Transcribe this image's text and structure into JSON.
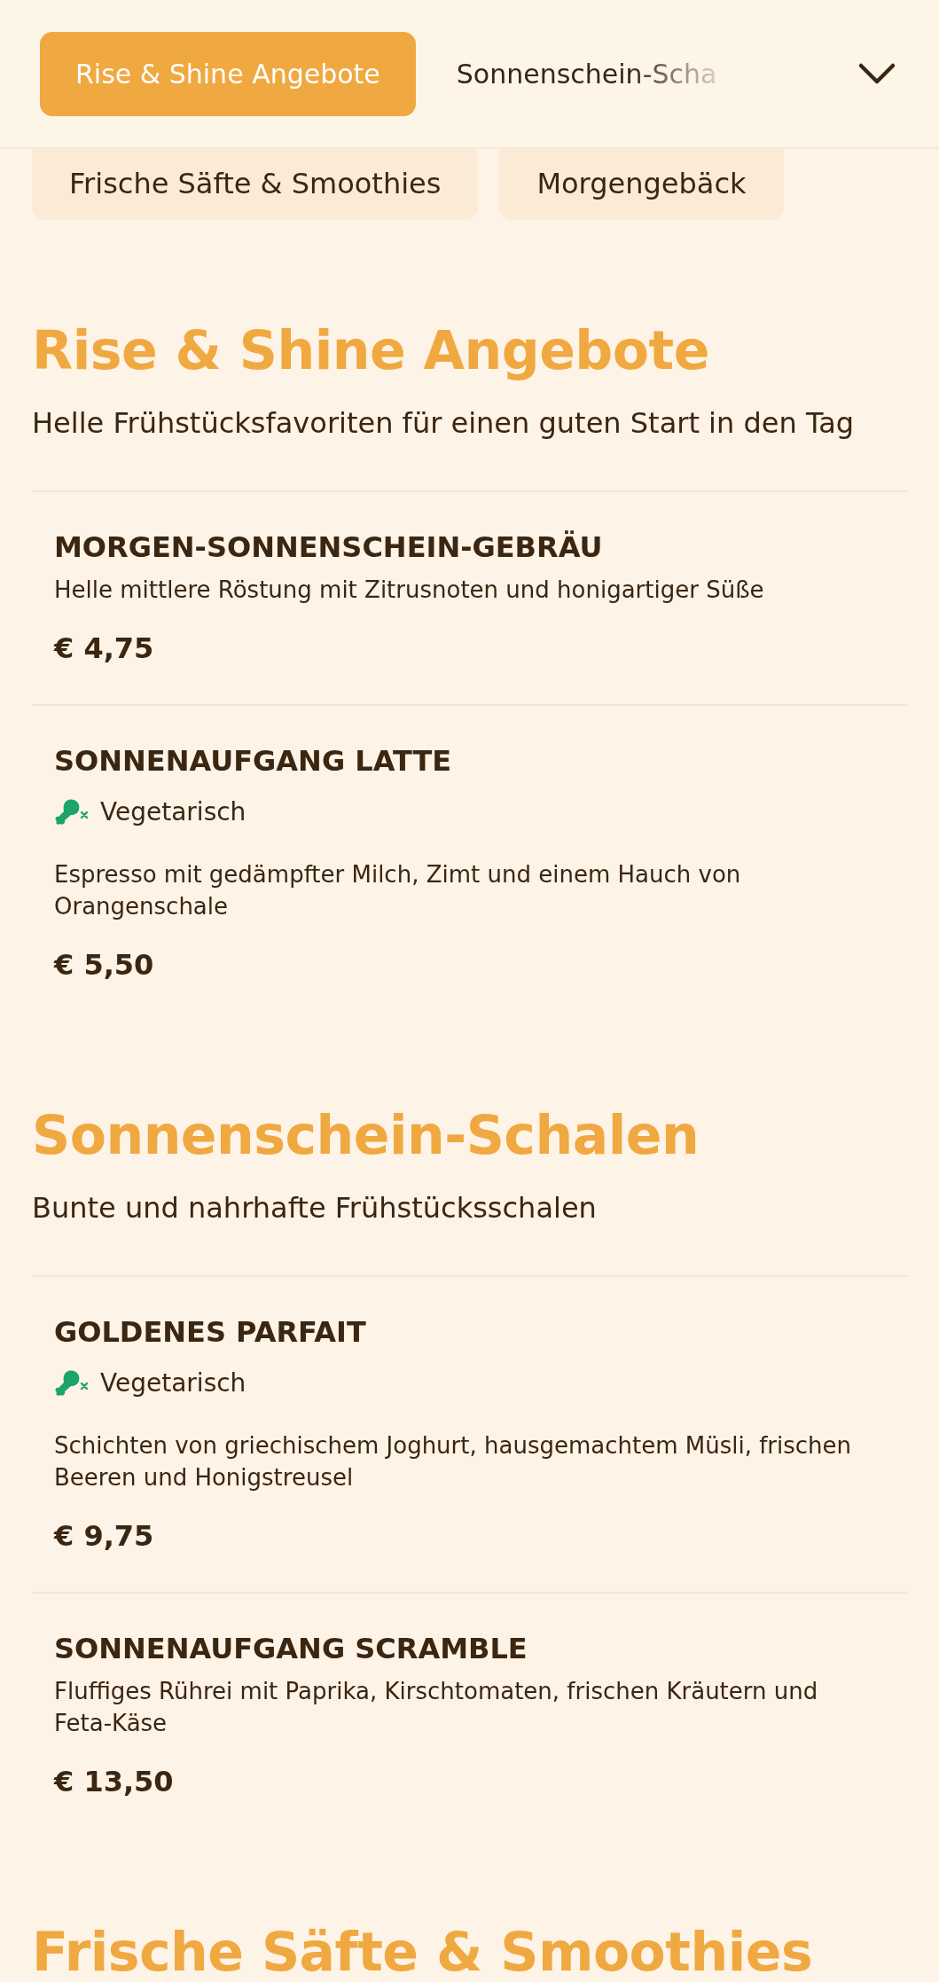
{
  "nav": {
    "tabs": [
      {
        "label": "Rise & Shine Angebote",
        "selected": true
      },
      {
        "label": "Sonnenschein-Scha",
        "selected": false
      }
    ],
    "tabs_row_2": [
      {
        "label": "Frische Säfte & Smoothies",
        "selected": false
      },
      {
        "label": "Morgengebäck",
        "selected": false
      }
    ]
  },
  "sections": [
    {
      "title": "Rise & Shine Angebote",
      "subtitle": "Helle Frühstücksfavoriten für einen guten Start in den Tag",
      "items": [
        {
          "name": "MORGEN-SONNENSCHEIN-GEBRÄU",
          "description": "Helle mittlere Röstung mit Zitrusnoten und honigartiger Süße",
          "price": "€ 4,75"
        },
        {
          "name": "SONNENAUFGANG LATTE",
          "tags": [
            {
              "label": "Vegetarisch",
              "kind": "vegetarian"
            }
          ],
          "description": "Espresso mit gedämpfter Milch, Zimt und einem Hauch von Orangenschale",
          "price": "€ 5,50"
        }
      ]
    },
    {
      "title": "Sonnenschein-Schalen",
      "subtitle": "Bunte und nahrhafte Frühstücksschalen",
      "items": [
        {
          "name": "GOLDENES PARFAIT",
          "tags": [
            {
              "label": "Vegetarisch",
              "kind": "vegetarian"
            }
          ],
          "description": "Schichten von griechischem Joghurt, hausgemachtem Müsli, frischen Beeren und Honigstreusel",
          "price": "€ 9,75"
        },
        {
          "name": "SONNENAUFGANG SCRAMBLE",
          "description": "Fluffiges Rührei mit Paprika, Kirschtomaten, frischen Kräutern und Feta-Käse",
          "price": "€ 13,50"
        }
      ]
    },
    {
      "title": "Frische Säfte & Smoothies"
    }
  ]
}
